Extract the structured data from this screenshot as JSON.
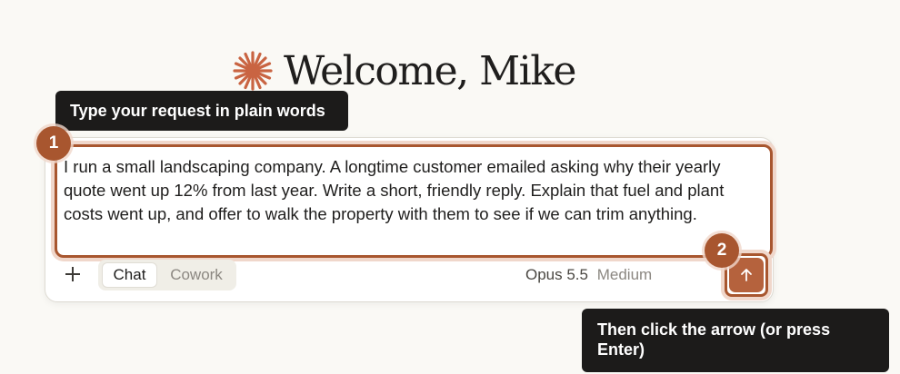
{
  "welcome": {
    "title": "Welcome, Mike",
    "logo_icon": "asterisk-burst-icon",
    "logo_color": "#c96442"
  },
  "tooltips": {
    "step1": "Type your request in plain words",
    "step2": "Then click the arrow (or press Enter)"
  },
  "steps": {
    "one": "1",
    "two": "2"
  },
  "composer": {
    "prompt": "I run a small landscaping company. A longtime customer emailed asking why their yearly quote went up 12% from last year. Write a short, friendly reply. Explain that fuel and plant costs went up, and offer to walk the property with them to see if we can trim anything.",
    "add_icon": "plus-icon",
    "modes": {
      "chat": "Chat",
      "cowork": "Cowork",
      "selected": "Chat"
    },
    "model": {
      "name": "Opus 5.5",
      "effort": "Medium"
    },
    "send_icon": "arrow-up-icon"
  },
  "colors": {
    "accent": "#a8562f",
    "send_button": "#b5623d",
    "background": "#faf9f5",
    "tooltip": "#1c1b1a"
  }
}
